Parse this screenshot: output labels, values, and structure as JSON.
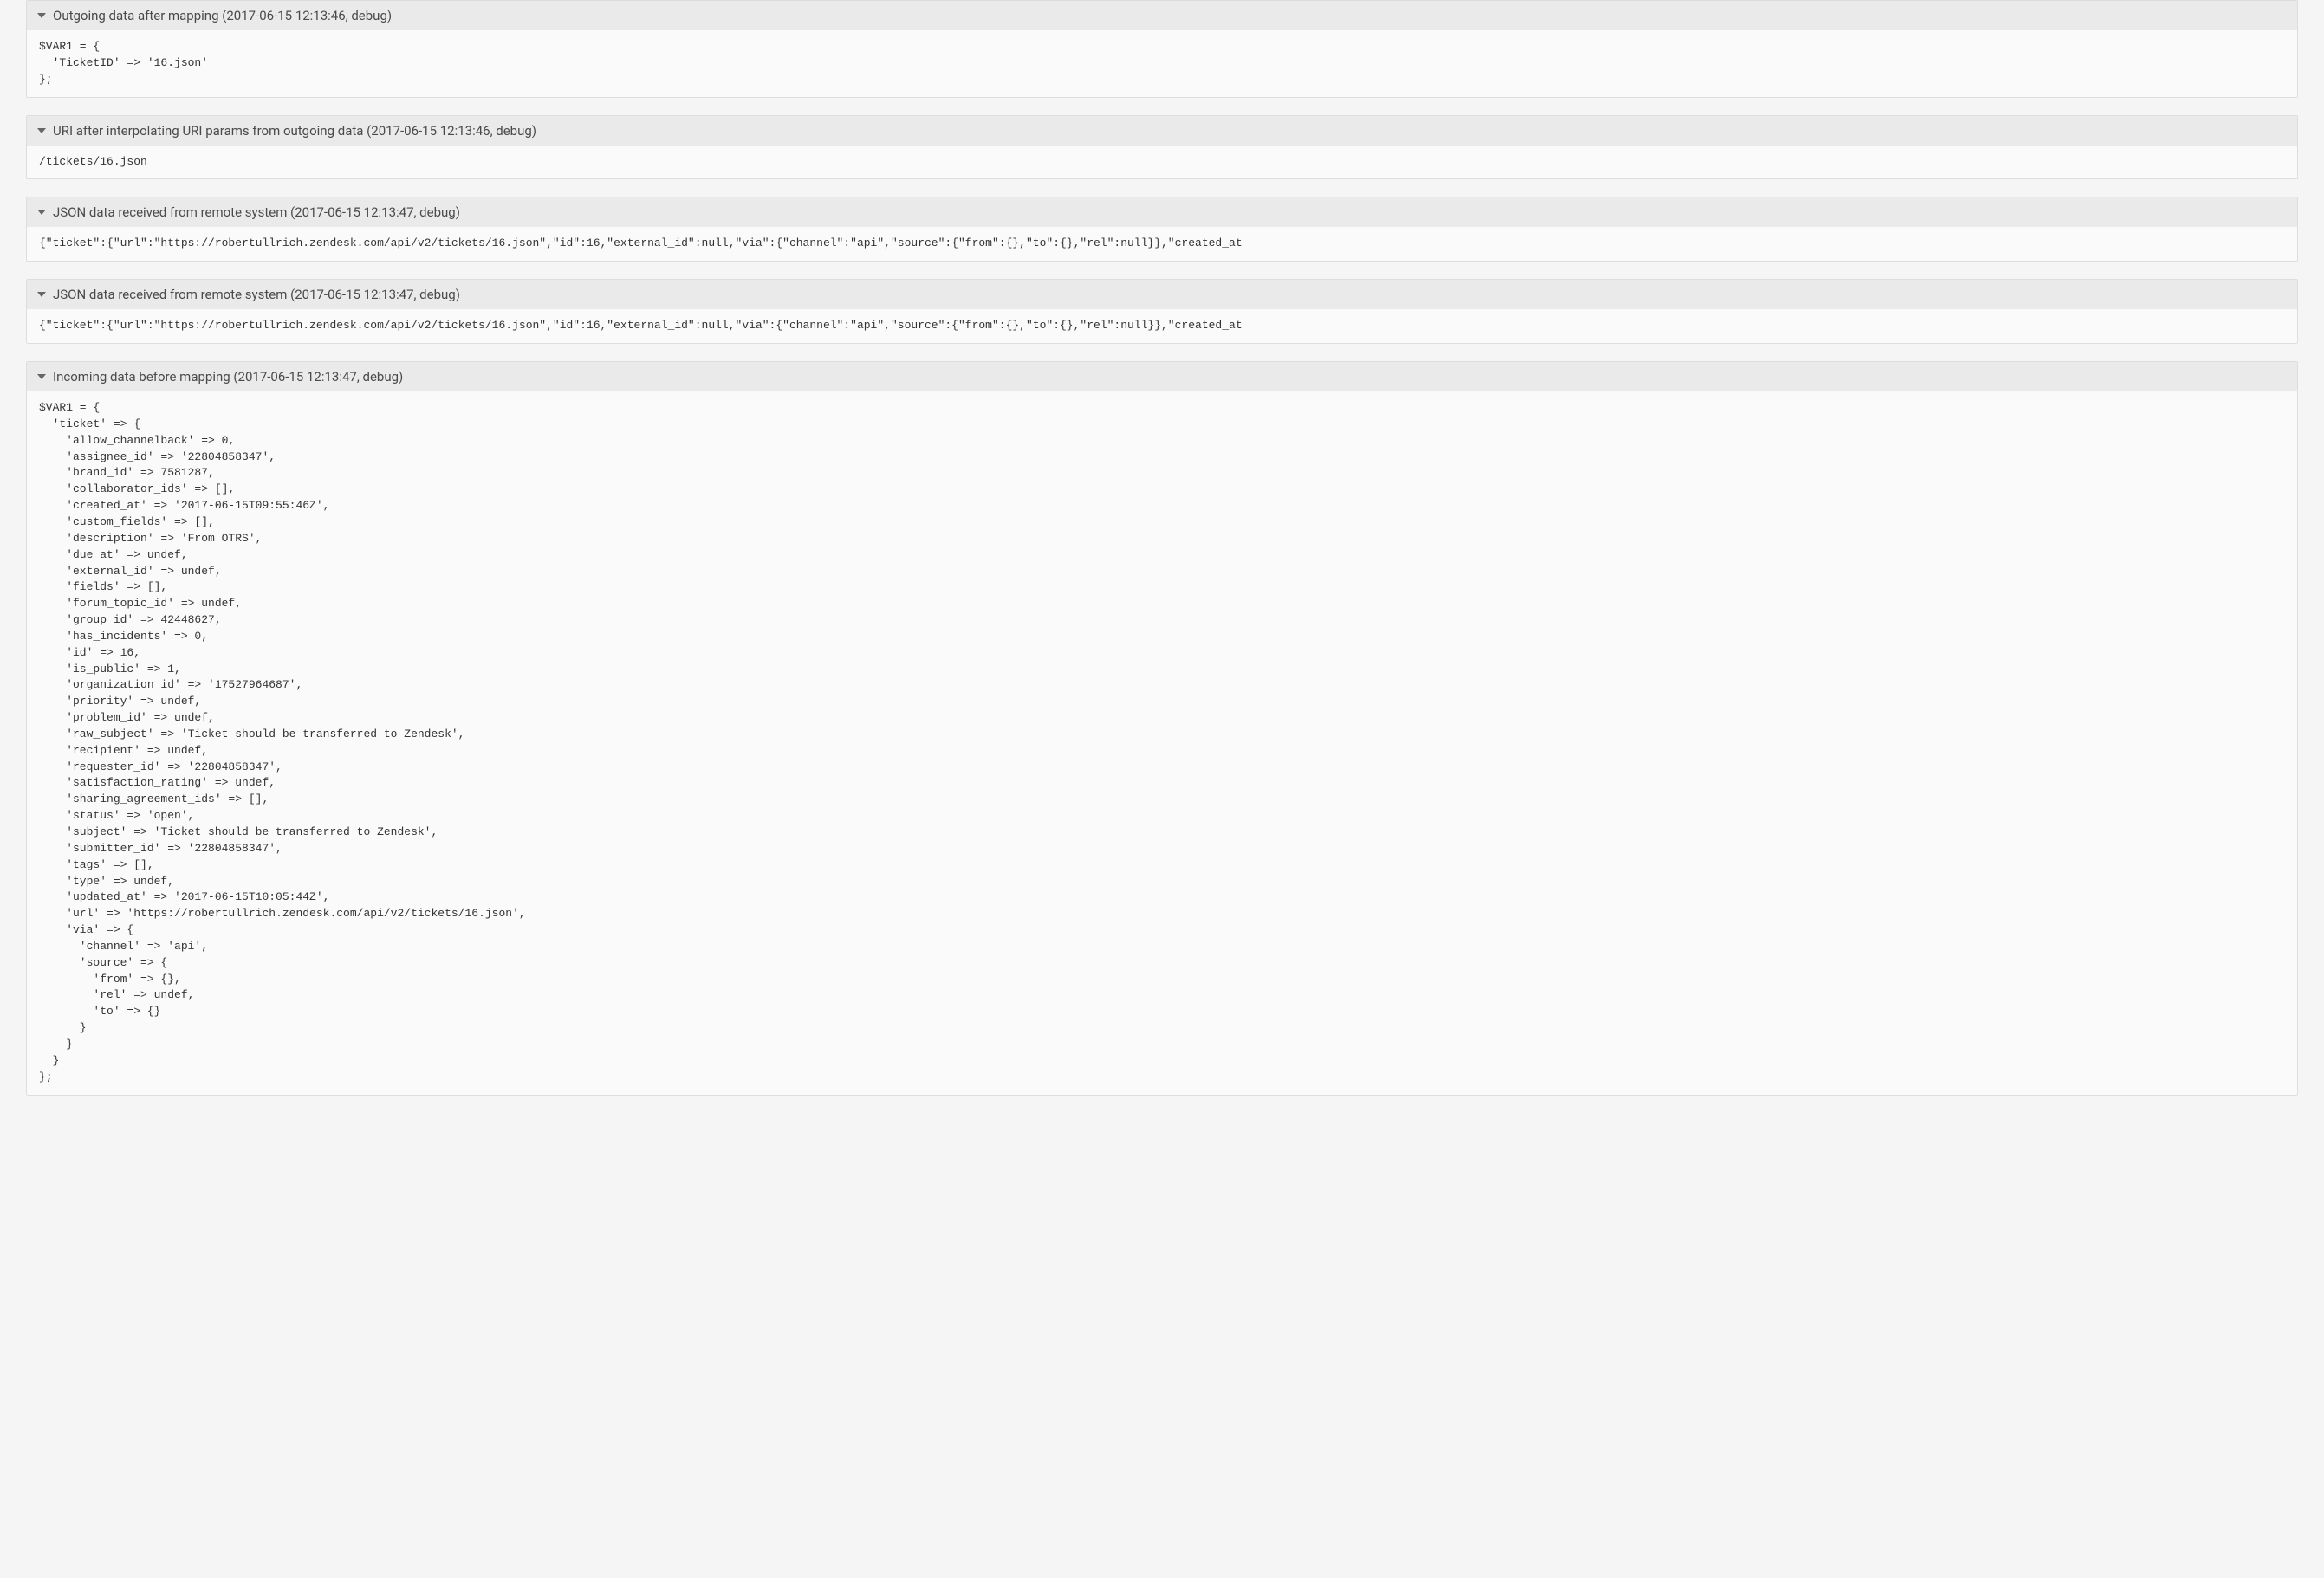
{
  "panels": [
    {
      "title": "Outgoing data after mapping (2017-06-15 12:13:46, debug)",
      "body": "$VAR1 = {\n  'TicketID' => '16.json'\n};"
    },
    {
      "title": "URI after interpolating URI params from outgoing data (2017-06-15 12:13:46, debug)",
      "body": "/tickets/16.json"
    },
    {
      "title": "JSON data received from remote system (2017-06-15 12:13:47, debug)",
      "body": "{\"ticket\":{\"url\":\"https://robertullrich.zendesk.com/api/v2/tickets/16.json\",\"id\":16,\"external_id\":null,\"via\":{\"channel\":\"api\",\"source\":{\"from\":{},\"to\":{},\"rel\":null}},\"created_at"
    },
    {
      "title": "JSON data received from remote system (2017-06-15 12:13:47, debug)",
      "body": "{\"ticket\":{\"url\":\"https://robertullrich.zendesk.com/api/v2/tickets/16.json\",\"id\":16,\"external_id\":null,\"via\":{\"channel\":\"api\",\"source\":{\"from\":{},\"to\":{},\"rel\":null}},\"created_at"
    },
    {
      "title": "Incoming data before mapping (2017-06-15 12:13:47, debug)",
      "body": "$VAR1 = {\n  'ticket' => {\n    'allow_channelback' => 0,\n    'assignee_id' => '22804858347',\n    'brand_id' => 7581287,\n    'collaborator_ids' => [],\n    'created_at' => '2017-06-15T09:55:46Z',\n    'custom_fields' => [],\n    'description' => 'From OTRS',\n    'due_at' => undef,\n    'external_id' => undef,\n    'fields' => [],\n    'forum_topic_id' => undef,\n    'group_id' => 42448627,\n    'has_incidents' => 0,\n    'id' => 16,\n    'is_public' => 1,\n    'organization_id' => '17527964687',\n    'priority' => undef,\n    'problem_id' => undef,\n    'raw_subject' => 'Ticket should be transferred to Zendesk',\n    'recipient' => undef,\n    'requester_id' => '22804858347',\n    'satisfaction_rating' => undef,\n    'sharing_agreement_ids' => [],\n    'status' => 'open',\n    'subject' => 'Ticket should be transferred to Zendesk',\n    'submitter_id' => '22804858347',\n    'tags' => [],\n    'type' => undef,\n    'updated_at' => '2017-06-15T10:05:44Z',\n    'url' => 'https://robertullrich.zendesk.com/api/v2/tickets/16.json',\n    'via' => {\n      'channel' => 'api',\n      'source' => {\n        'from' => {},\n        'rel' => undef,\n        'to' => {}\n      }\n    }\n  }\n};"
    }
  ]
}
